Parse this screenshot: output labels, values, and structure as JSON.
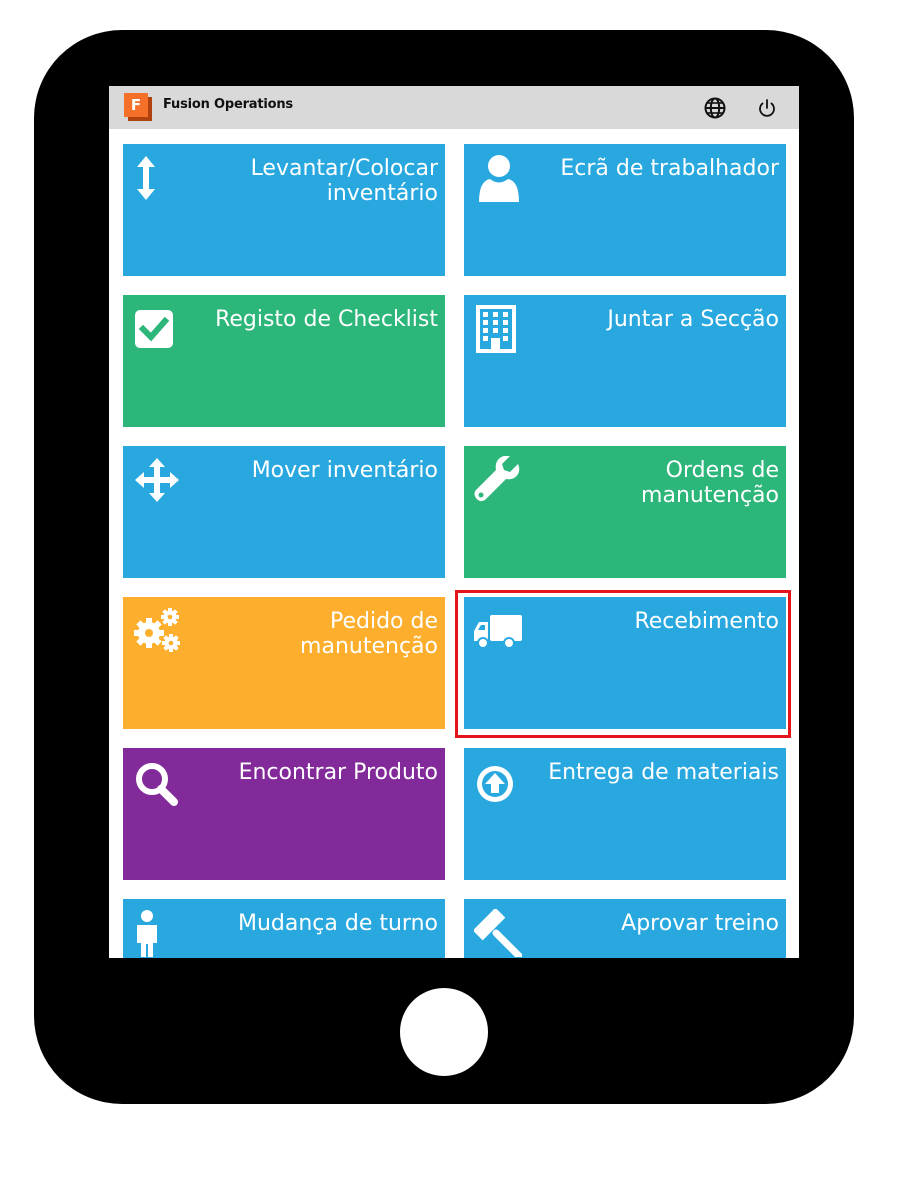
{
  "header": {
    "app_title": "Fusion Operations",
    "logo_letter": "F",
    "icons": [
      "globe-icon",
      "power-icon"
    ]
  },
  "colors": {
    "blue": "#29a8e0",
    "green": "#2cb67a",
    "orange": "#fdae2c",
    "purple": "#832a9a",
    "highlight": "#e3141b"
  },
  "tiles": [
    {
      "label": "Levantar/Colocar\ninventário",
      "icon": "vertical-arrows-icon",
      "color": "#29a8e0"
    },
    {
      "label": "Ecrã de trabalhador",
      "icon": "user-icon",
      "color": "#29a8e0"
    },
    {
      "label": "Registo de Checklist",
      "icon": "checkbox-icon",
      "color": "#2cb67a"
    },
    {
      "label": "Juntar a Secção",
      "icon": "building-icon",
      "color": "#29a8e0"
    },
    {
      "label": "Mover inventário",
      "icon": "move-arrows-icon",
      "color": "#29a8e0"
    },
    {
      "label": "Ordens de\nmanutenção",
      "icon": "wrench-icon",
      "color": "#2cb67a"
    },
    {
      "label": "Pedido de\nmanutenção",
      "icon": "gears-icon",
      "color": "#fdae2c"
    },
    {
      "label": "Recebimento",
      "icon": "truck-icon",
      "color": "#29a8e0",
      "highlighted": true
    },
    {
      "label": "Encontrar Produto",
      "icon": "magnifier-icon",
      "color": "#832a9a"
    },
    {
      "label": "Entrega de materiais",
      "icon": "upload-circle-icon",
      "color": "#29a8e0"
    },
    {
      "label": "Mudança de turno",
      "icon": "person-icon",
      "color": "#29a8e0"
    },
    {
      "label": "Aprovar treino",
      "icon": "gavel-icon",
      "color": "#29a8e0"
    }
  ]
}
